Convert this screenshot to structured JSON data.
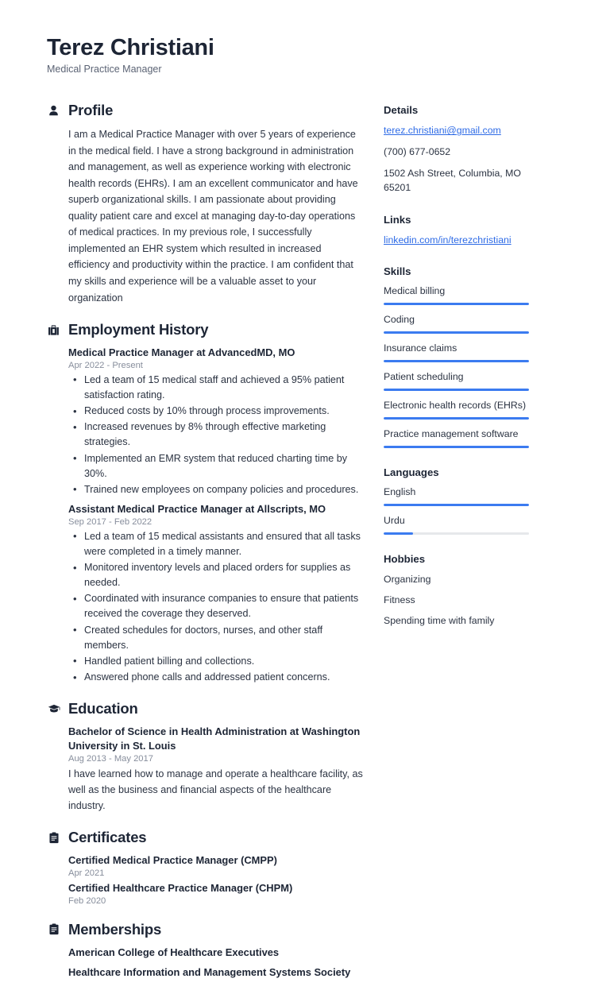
{
  "header": {
    "full_name": "Terez Christiani",
    "job_title": "Medical Practice Manager"
  },
  "accent_color": "#3b7bf0",
  "link_color": "#2e6be6",
  "text_color": "#2b3342",
  "muted_color": "#878e9c",
  "main": {
    "profile": {
      "icon": "person-icon",
      "title": "Profile",
      "text": "I am a Medical Practice Manager with over 5 years of experience in the medical field. I have a strong background in administration and management, as well as experience working with electronic health records (EHRs). I am an excellent communicator and have superb organizational skills. I am passionate about providing quality patient care and excel at managing day-to-day operations of medical practices. In my previous role, I successfully implemented an EHR system which resulted in increased efficiency and productivity within the practice. I am confident that my skills and experience will be a valuable asset to your organization"
    },
    "employment": {
      "icon": "briefcase-icon",
      "title": "Employment History",
      "entries": [
        {
          "title": "Medical Practice Manager at AdvancedMD, MO",
          "date": "Apr 2022 - Present",
          "bullets": [
            "Led a team of 15 medical staff and achieved a 95% patient satisfaction rating.",
            "Reduced costs by 10% through process improvements.",
            "Increased revenues by 8% through effective marketing strategies.",
            "Implemented an EMR system that reduced charting time by 30%.",
            "Trained new employees on company policies and procedures."
          ]
        },
        {
          "title": "Assistant Medical Practice Manager at Allscripts, MO",
          "date": "Sep 2017 - Feb 2022",
          "bullets": [
            "Led a team of 15 medical assistants and ensured that all tasks were completed in a timely manner.",
            "Monitored inventory levels and placed orders for supplies as needed.",
            "Coordinated with insurance companies to ensure that patients received the coverage they deserved.",
            "Created schedules for doctors, nurses, and other staff members.",
            "Handled patient billing and collections.",
            "Answered phone calls and addressed patient concerns."
          ]
        }
      ]
    },
    "education": {
      "icon": "graduation-cap-icon",
      "title": "Education",
      "entries": [
        {
          "title": "Bachelor of Science in Health Administration at Washington University in St. Louis",
          "date": "Aug 2013 - May 2017",
          "description": "I have learned how to manage and operate a healthcare facility, as well as the business and financial aspects of the healthcare industry."
        }
      ]
    },
    "certificates": {
      "icon": "clipboard-icon",
      "title": "Certificates",
      "entries": [
        {
          "title": "Certified Medical Practice Manager (CMPP)",
          "date": "Apr 2021"
        },
        {
          "title": "Certified Healthcare Practice Manager (CHPM)",
          "date": "Feb 2020"
        }
      ]
    },
    "memberships": {
      "icon": "clipboard-icon",
      "title": "Memberships",
      "entries": [
        {
          "title": "American College of Healthcare Executives"
        },
        {
          "title": "Healthcare Information and Management Systems Society"
        }
      ]
    }
  },
  "sidebar": {
    "details": {
      "title": "Details",
      "email": "terez.christiani@gmail.com",
      "phone": "(700) 677-0652",
      "address": "1502 Ash Street, Columbia, MO 65201"
    },
    "links": {
      "title": "Links",
      "items": [
        {
          "label": "linkedin.com/in/terezchristiani"
        }
      ]
    },
    "skills": {
      "title": "Skills",
      "items": [
        {
          "label": "Medical billing",
          "level": 100
        },
        {
          "label": "Coding",
          "level": 100
        },
        {
          "label": "Insurance claims",
          "level": 100
        },
        {
          "label": "Patient scheduling",
          "level": 100
        },
        {
          "label": "Electronic health records (EHRs)",
          "level": 100
        },
        {
          "label": "Practice management software",
          "level": 100
        }
      ]
    },
    "languages": {
      "title": "Languages",
      "items": [
        {
          "label": "English",
          "level": 100
        },
        {
          "label": "Urdu",
          "level": 20
        }
      ]
    },
    "hobbies": {
      "title": "Hobbies",
      "items": [
        {
          "label": "Organizing"
        },
        {
          "label": "Fitness"
        },
        {
          "label": "Spending time with family"
        }
      ]
    }
  }
}
